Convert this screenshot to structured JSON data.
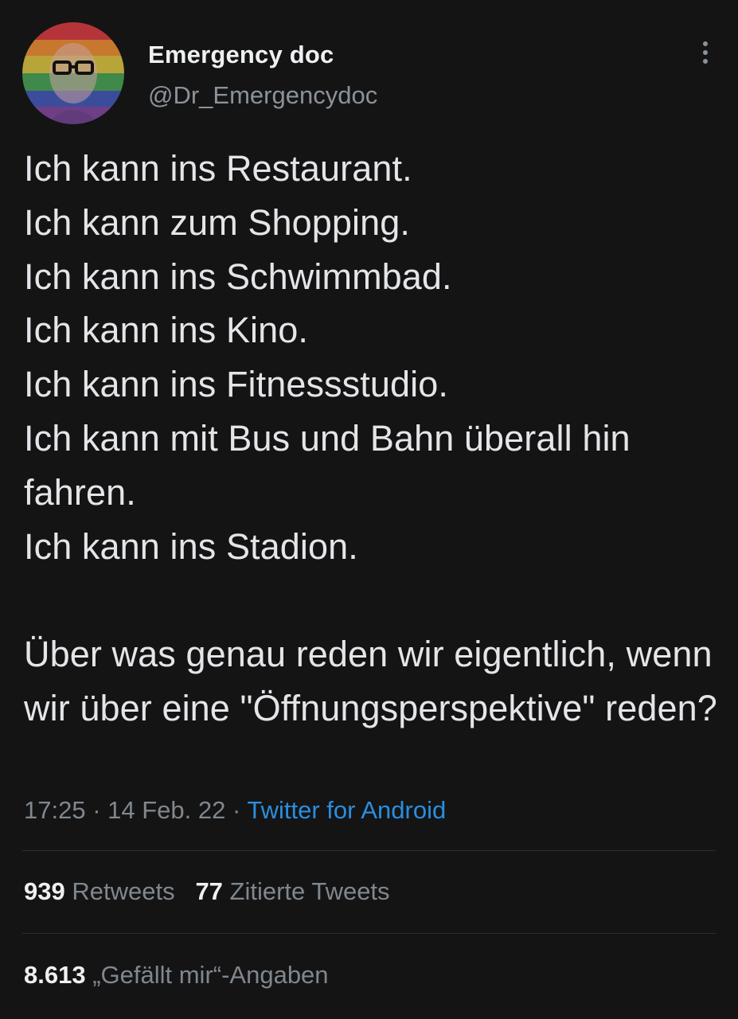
{
  "user": {
    "display_name": "Emergency doc",
    "handle": "@Dr_Emergencydoc",
    "avatar_icon": "profile-avatar-rainbow"
  },
  "tweet": {
    "text": "Ich kann ins Restaurant.\nIch kann zum Shopping.\nIch kann ins Schwimmbad.\nIch kann ins Kino.\nIch kann ins Fitnessstudio.\nIch kann mit Bus und Bahn überall hin fahren.\nIch kann ins Stadion.\n\nÜber was genau reden wir eigentlich, wenn wir über eine \"Öffnungsperspektive\" reden?",
    "time": "17:25",
    "separator": "·",
    "date": "14 Feb. 22",
    "source": "Twitter for Android"
  },
  "stats": {
    "retweets_count": "939",
    "retweets_label": "Retweets",
    "quotes_count": "77",
    "quotes_label": "Zitierte Tweets",
    "likes_count": "8.613",
    "likes_label": "„Gefällt mir“-Angaben"
  },
  "colors": {
    "background": "#141414",
    "link": "#2b8de0",
    "muted": "#80878e",
    "text": "#e3e5e8"
  },
  "icons": {
    "more": "more-vertical-icon"
  }
}
